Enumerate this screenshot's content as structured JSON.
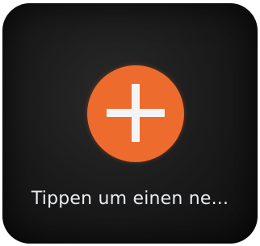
{
  "screen": {
    "hint_text": "Tippen um einen ne...",
    "add_button_icon": "plus-icon",
    "colors": {
      "background": "#1c1c1c",
      "accent": "#ee6b2e",
      "icon": "#f4f4f4",
      "text": "#e9ecf2"
    }
  }
}
